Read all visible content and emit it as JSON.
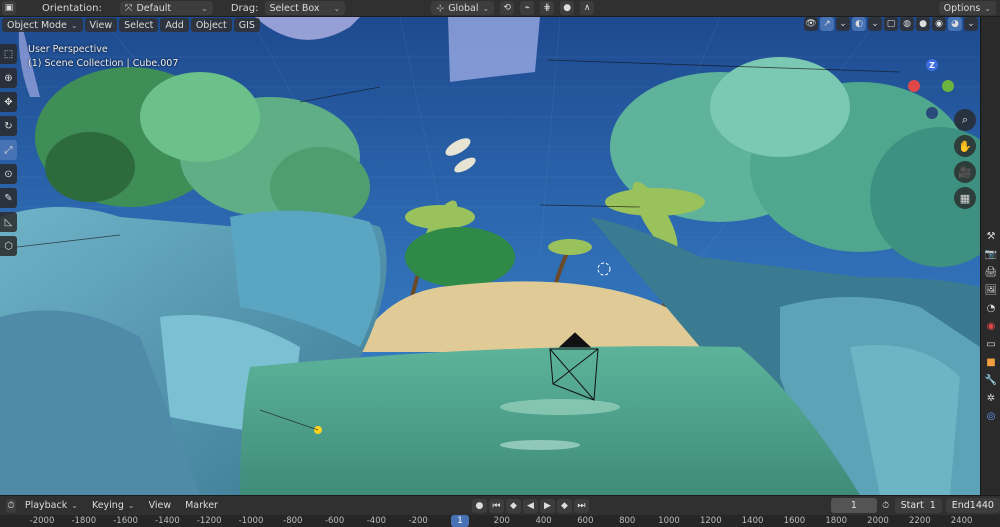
{
  "header": {
    "orientation_label": "Orientation:",
    "orientation_value": "Default",
    "drag_label": "Drag:",
    "drag_value": "Select Box",
    "transform_orientation": "Global",
    "options_label": "Options"
  },
  "viewport_header": {
    "mode": "Object Mode",
    "menus": [
      "View",
      "Select",
      "Add",
      "Object",
      "GIS"
    ]
  },
  "viewport_overlay": {
    "perspective": "User Perspective",
    "collection": "(1) Scene Collection | Cube.007"
  },
  "gizmo": {
    "z_label": "Z"
  },
  "timeline": {
    "menus": [
      "Playback",
      "Keying",
      "View",
      "Marker"
    ],
    "current_frame": "1",
    "start_label": "Start",
    "start_value": "1",
    "end_label": "End",
    "end_value": "1440"
  },
  "ruler": {
    "ticks": [
      "-2000",
      "-1800",
      "-1600",
      "-1400",
      "-1200",
      "-1000",
      "-800",
      "-600",
      "-400",
      "-200",
      "1",
      "200",
      "400",
      "600",
      "800",
      "1000",
      "1200",
      "1400",
      "1600",
      "1800",
      "2000",
      "2200",
      "2400"
    ],
    "current": "1"
  },
  "colors": {
    "accent": "#4772b3",
    "sky_top": "#1e4a8f",
    "sky_bottom": "#3a86c6",
    "water": "#4fa68e",
    "sand": "#e0cb97"
  }
}
